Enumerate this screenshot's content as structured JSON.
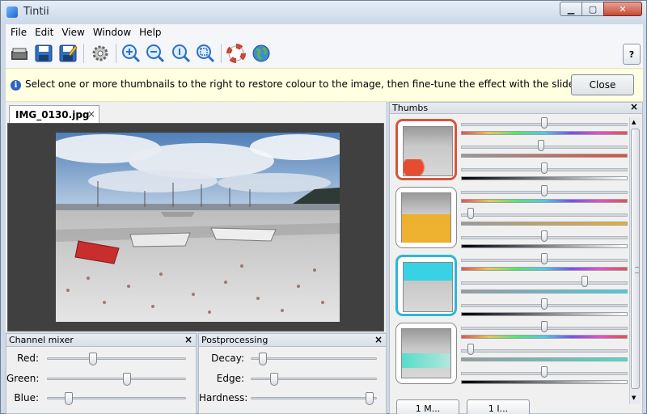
{
  "window": {
    "title": "Tintii"
  },
  "menu": [
    "File",
    "Edit",
    "View",
    "Window",
    "Help"
  ],
  "toolbar": {
    "icons": [
      "open-icon",
      "save-icon",
      "save-as-icon",
      "settings-icon",
      "zoom-in-icon",
      "zoom-out-icon",
      "zoom-actual-icon",
      "zoom-fit-icon",
      "help-lifebuoy-icon",
      "globe-icon"
    ],
    "help_label": "?"
  },
  "info": {
    "message": "Select one or more thumbnails to the right to restore colour to the image, then fine-tune the effect with the sliders.",
    "close_label": "Close"
  },
  "document": {
    "tab_label": "IMG_0130.jpg",
    "tab_close": "×"
  },
  "channel_mixer": {
    "title": "Channel mixer",
    "close": "×",
    "sliders": [
      {
        "label": "Red:",
        "value": 0.32
      },
      {
        "label": "Green:",
        "value": 0.58
      },
      {
        "label": "Blue:",
        "value": 0.13
      }
    ]
  },
  "postprocessing": {
    "title": "Postprocessing",
    "close": "×",
    "sliders": [
      {
        "label": "Decay:",
        "value": 0.06
      },
      {
        "label": "Edge:",
        "value": 0.16
      },
      {
        "label": "Hardness:",
        "value": 0.98
      }
    ]
  },
  "thumbs": {
    "title": "Thumbs",
    "close": "×",
    "items": [
      {
        "selected": true,
        "color": "#d5553f",
        "hue": 0.5,
        "sat": 0.48,
        "light": 0.5,
        "accent": "#e74c2e"
      },
      {
        "selected": false,
        "color": "#8a8a8a",
        "hue": 0.5,
        "sat": 0.04,
        "light": 0.5,
        "accent": "#f1ad1e"
      },
      {
        "selected": true,
        "color": "#2fb6d6",
        "hue": 0.5,
        "sat": 0.75,
        "light": 0.5,
        "accent": "#39d2e5"
      },
      {
        "selected": false,
        "color": "#8a8a8a",
        "hue": 0.5,
        "sat": 0.04,
        "light": 0.5,
        "accent": "#40e0c8"
      }
    ],
    "buttons": [
      "1 M...",
      "1 I..."
    ]
  }
}
